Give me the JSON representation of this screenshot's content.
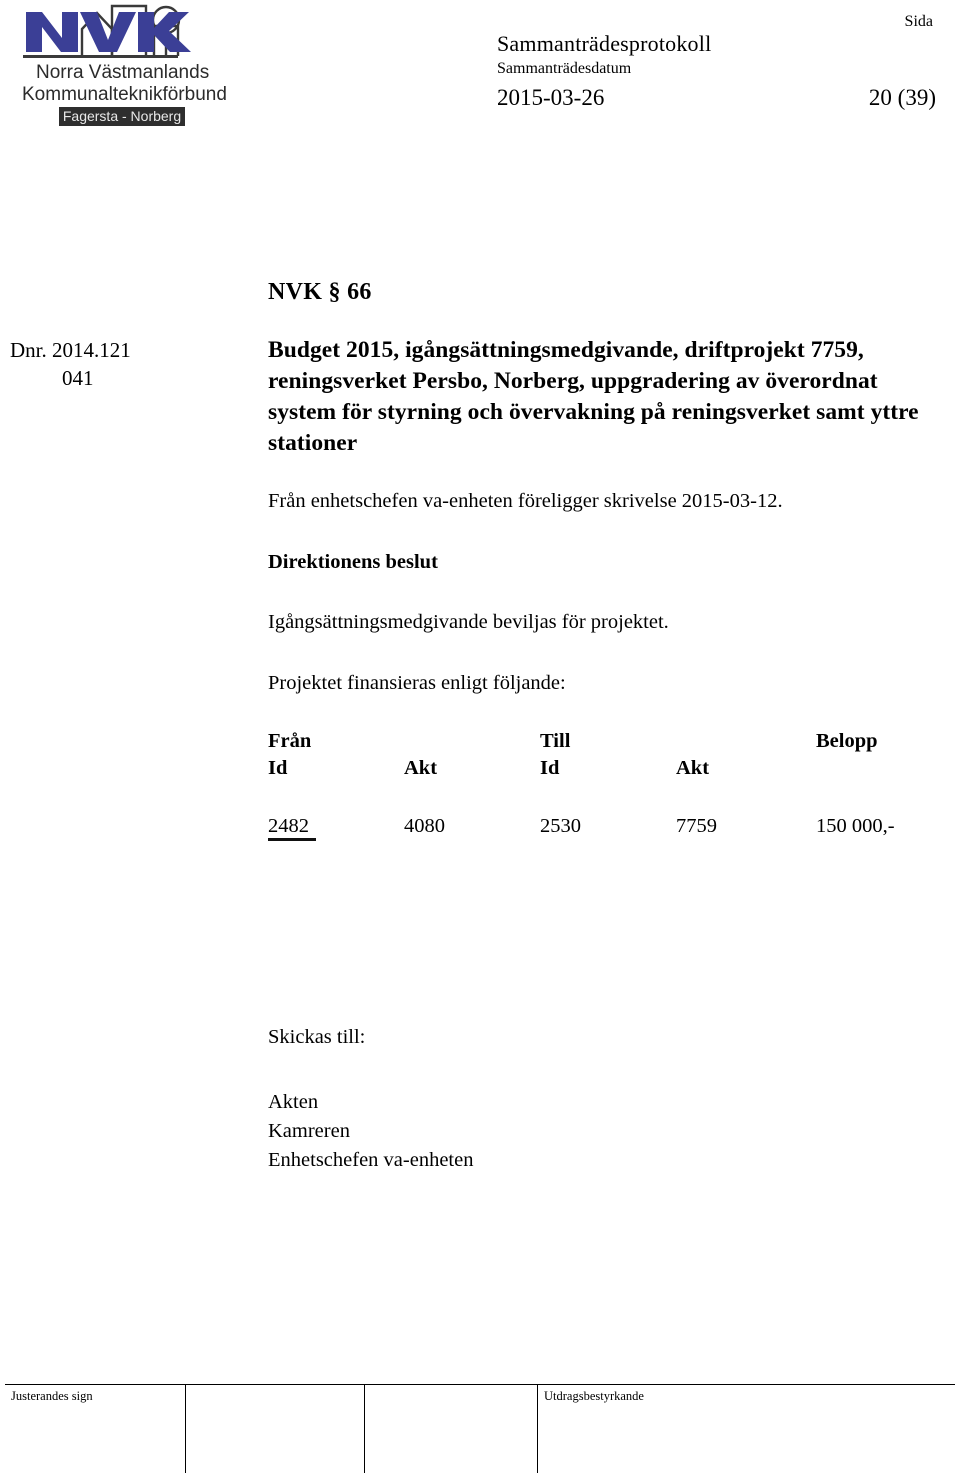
{
  "logo": {
    "alt_name": "nvk-logo",
    "acronym": "NVK",
    "org_line1": "Norra Västmanlands",
    "org_line2": "Kommunalteknikförbund",
    "badge": "Fagersta - Norberg",
    "brand_blue": "#3b3f96",
    "badge_bg": "#2e2e2e",
    "badge_fg": "#e8e8e8"
  },
  "header": {
    "protocol_title": "Sammanträdesprotokoll",
    "date_label": "Sammanträdesdatum",
    "date_value": "2015-03-26",
    "page_label": "Sida",
    "page_value": "20 (39)"
  },
  "margin": {
    "dnr_line1": "Dnr. 2014.121",
    "dnr_line2": "041"
  },
  "main": {
    "section_number": "NVK § 66",
    "case_title": "Budget 2015, igångsättningsmedgivande, driftprojekt 7759, reningsverket Persbo, Norberg, uppgradering av överordnat system för styrning och övervakning på reningsverket samt yttre stationer",
    "source_paragraph": "Från enhetschefen va-enheten föreligger skrivelse 2015-03-12.",
    "decision_heading": "Direktionens beslut",
    "decision_text": "Igångsättningsmedgivande beviljas för projektet.",
    "finance_note": "Projektet finansieras enligt följande:"
  },
  "finance_table": {
    "group_headers": {
      "from": "Från",
      "to": "Till",
      "amount": "Belopp"
    },
    "sub_headers": {
      "from_id": "Id",
      "from_akt": "Akt",
      "to_id": "Id",
      "to_akt": "Akt",
      "amount_blank": ""
    },
    "rows": [
      {
        "from_id": "2482",
        "from_akt": "4080",
        "to_id": "2530",
        "to_akt": "7759",
        "amount": "150 000,-"
      }
    ]
  },
  "distribution": {
    "heading": "Skickas till:",
    "recipients": [
      "Akten",
      "Kamreren",
      "Enhetschefen va-enheten"
    ]
  },
  "footer": {
    "signature_label": "Justerandes sign",
    "cell2": "",
    "cell3": "",
    "certification_label": "Utdragsbestyrkande"
  }
}
